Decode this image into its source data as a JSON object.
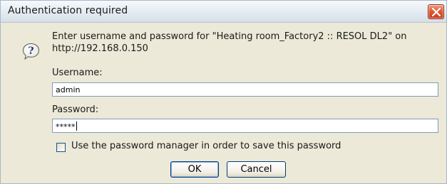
{
  "dialog": {
    "title": "Authentication required",
    "prompt": "Enter username and password for \"Heating room_Factory2 :: RESOL DL2\" on http://192.168.0.150",
    "username_label": "Username:",
    "username_value": "admin",
    "password_label": "Password:",
    "password_value": "*****",
    "remember_label": "Use the password manager in order to save this password",
    "remember_checked": false,
    "ok_label": "OK",
    "cancel_label": "Cancel"
  },
  "icons": {
    "close": "close-icon",
    "question": "question-icon"
  },
  "colors": {
    "close_button": "#d9482a",
    "dialog_background": "#ece9d8",
    "field_border": "#7f9db9"
  }
}
